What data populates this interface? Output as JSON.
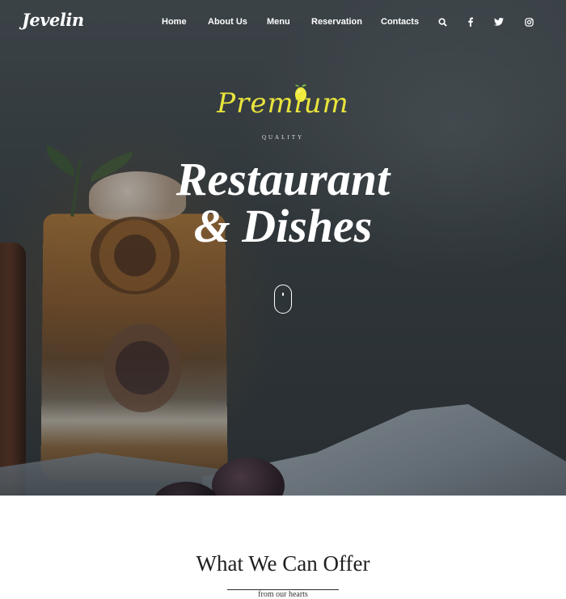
{
  "brand": {
    "logo_text": "Jevelin"
  },
  "nav": {
    "items": [
      {
        "label": "Home"
      },
      {
        "label": "About Us"
      },
      {
        "label": "Menu"
      },
      {
        "label": "Reservation"
      },
      {
        "label": "Contacts"
      }
    ],
    "icons": [
      "search-icon",
      "facebook-icon",
      "twitter-icon",
      "instagram-icon"
    ]
  },
  "hero": {
    "script_word": "Premium",
    "tagline": "QUALITY",
    "headline_line1": "Restaurant",
    "headline_line2": "& Dishes",
    "accent_color": "#e9e43c",
    "scroll_indicator": "mouse-scroll-icon"
  },
  "offer": {
    "title": "What We Can Offer",
    "subtitle": "from our hearts"
  }
}
